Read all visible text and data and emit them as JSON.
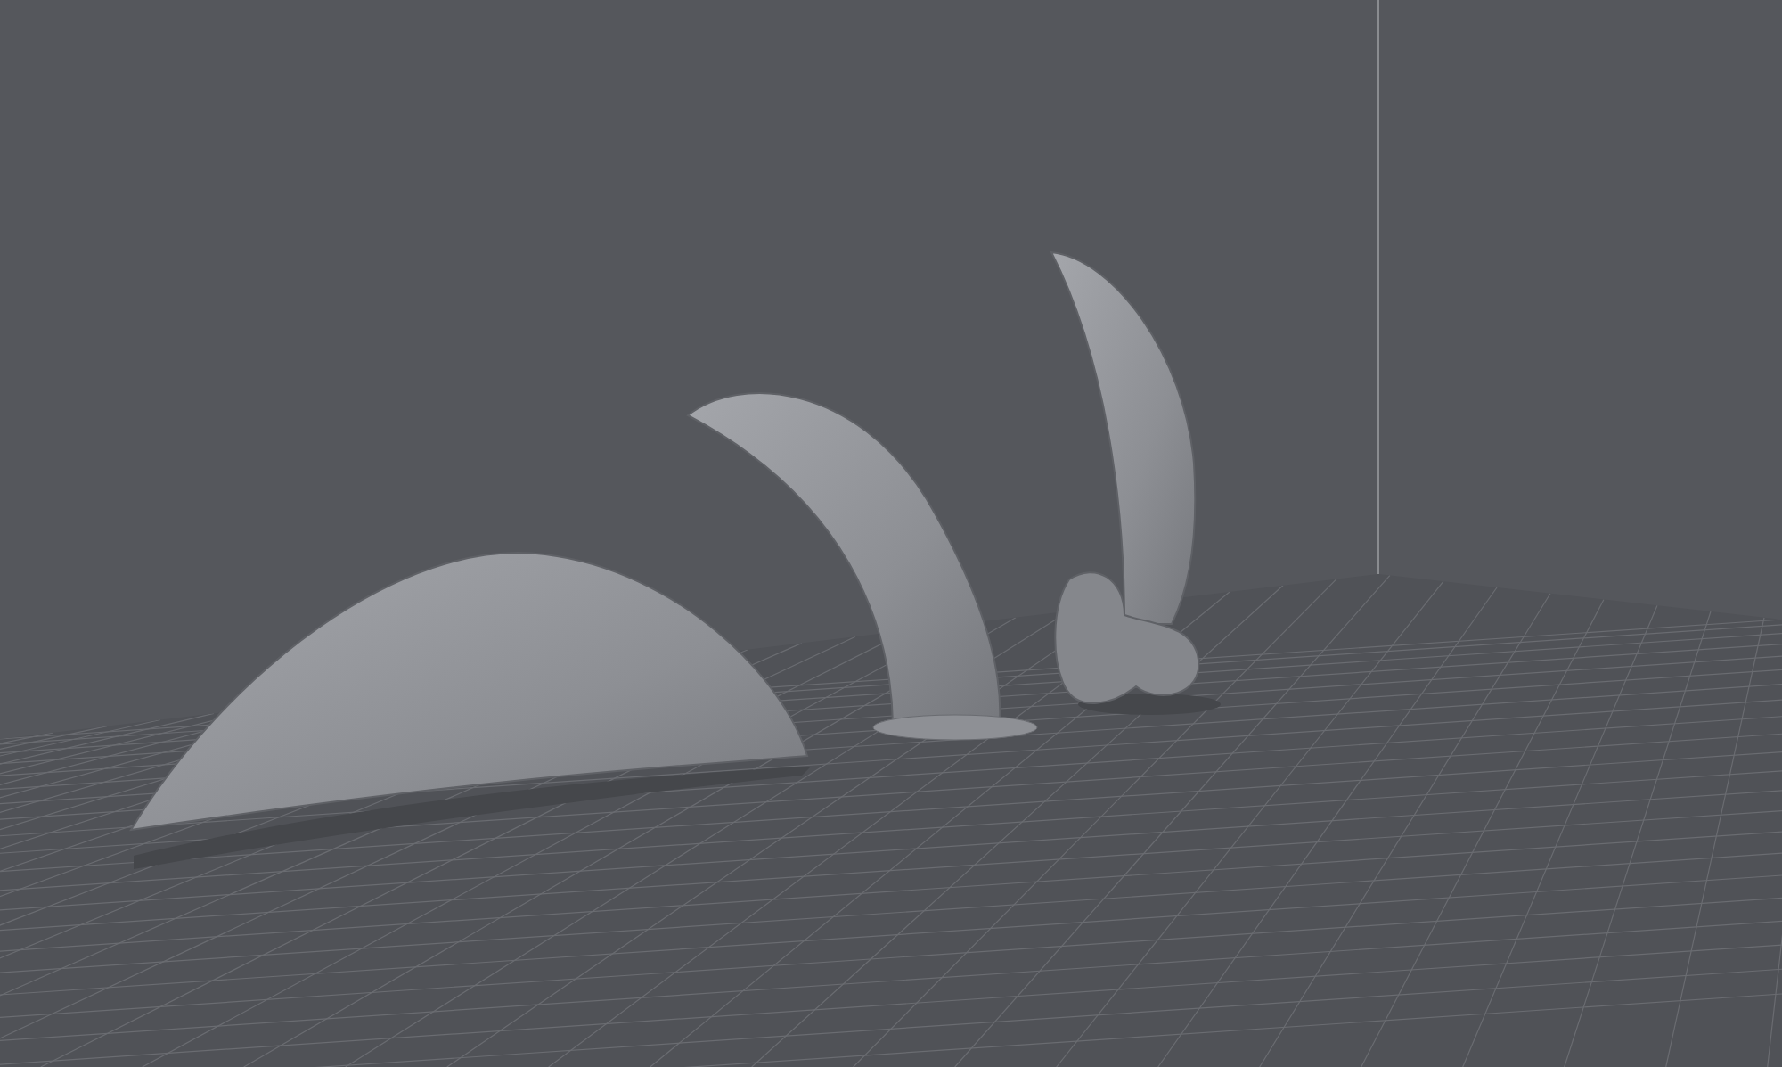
{
  "viewport": {
    "objects": [
      {
        "kind": "lying"
      },
      {
        "kind": "standing"
      },
      {
        "kind": "knuckle"
      }
    ]
  }
}
